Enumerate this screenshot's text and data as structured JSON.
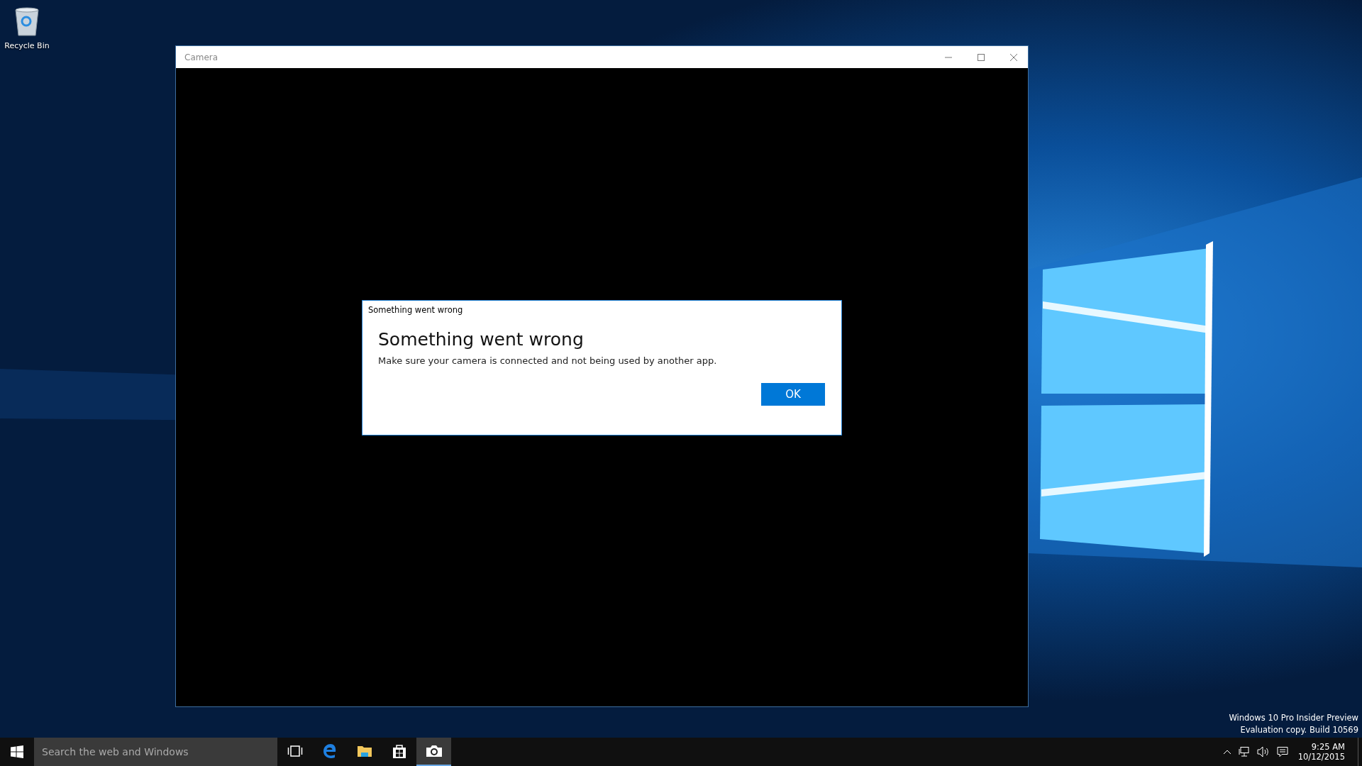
{
  "desktop": {
    "icons": [
      {
        "label": "Recycle Bin"
      }
    ]
  },
  "window": {
    "title": "Camera"
  },
  "dialog": {
    "caption": "Something went wrong",
    "heading": "Something went wrong",
    "message": "Make sure your camera is connected and not being used by another app.",
    "buttons": [
      "OK"
    ]
  },
  "evaluation_notice": [
    "Windows 10 Pro Insider Preview",
    "Evaluation copy. Build 10569"
  ],
  "taskbar": {
    "search": {
      "placeholder": "Search the web and Windows"
    },
    "apps": [
      {
        "kind": "taskview",
        "selected": false
      },
      {
        "kind": "browser",
        "selected": false
      },
      {
        "kind": "folder",
        "selected": false
      },
      {
        "kind": "store",
        "selected": false
      },
      {
        "kind": "camera",
        "selected": true
      }
    ],
    "clock": {
      "time": "9:25 AM",
      "date": "10/12/2015"
    }
  }
}
